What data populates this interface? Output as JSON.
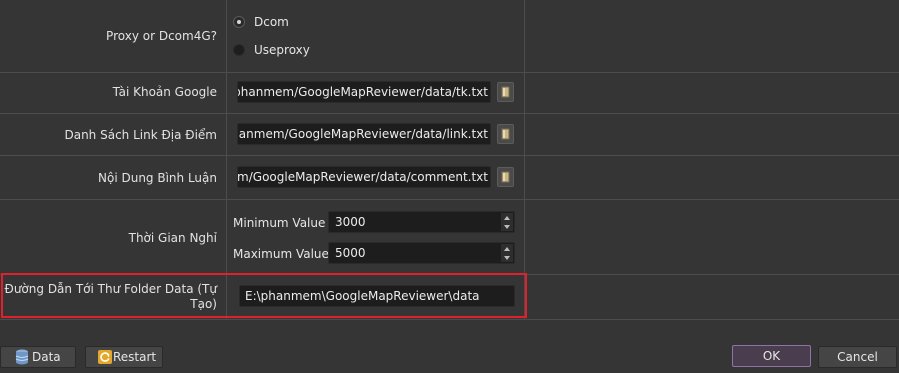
{
  "settings": {
    "proxy": {
      "label": "Proxy or Dcom4G?",
      "options": [
        "Dcom",
        "Useproxy"
      ],
      "selected": "Dcom"
    },
    "google_account": {
      "label": "Tài Khoản Google",
      "value": "E:\\phanmem/GoogleMapReviewer/data/tk.txt"
    },
    "link_list": {
      "label": "Danh Sách Link Địa Điểm",
      "value": "E:\\phanmem/GoogleMapReviewer/data/link.txt"
    },
    "comment_content": {
      "label": "Nội Dung Bình Luận",
      "value": "E:\\phanmem/GoogleMapReviewer/data/comment.txt"
    },
    "wait_time": {
      "label": "Thời Gian Nghỉ",
      "min_label": "Minimum Value",
      "min_value": "3000",
      "max_label": "Maximum Value",
      "max_value": "5000"
    },
    "data_folder": {
      "label_line1": "Đường Dẫn Tới Thư Folder Data (Tự",
      "label_line2": "Tạo)",
      "value": "E:\\phanmem\\GoogleMapReviewer\\data"
    }
  },
  "buttons": {
    "data": "Data",
    "restart": "Restart",
    "ok": "OK",
    "cancel": "Cancel"
  },
  "icons": {
    "browse": "folder-icon",
    "data": "database-icon",
    "restart": "refresh-icon"
  },
  "colors": {
    "background": "#353535",
    "input_background": "#1d1d1d",
    "highlight": "#e0202a",
    "ok_border": "#8f72a6"
  }
}
